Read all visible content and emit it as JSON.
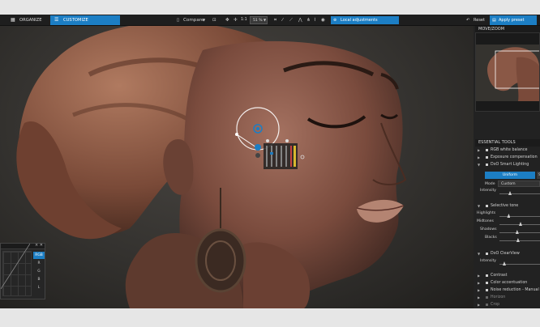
{
  "tabs": {
    "organize": "ORGANIZE",
    "customize": "CUSTOMIZE"
  },
  "toolbar": {
    "compare": "Compare",
    "zoom_ratio": "1:1",
    "zoom_value": "51 %",
    "local_adjustments": "Local adjustments",
    "reset": "Reset",
    "apply_preset": "Apply preset"
  },
  "move_zoom": {
    "title": "MOVE/ZOOM"
  },
  "essential_tools": {
    "title": "ESSENTIAL TOOLS",
    "items_top": [
      "RGB white balance",
      "Exposure compensation",
      "DxO Smart Lighting"
    ],
    "smart_lighting": {
      "mode_uniform": "Uniform",
      "mode_other": "Sp",
      "mode_label": "Mode",
      "mode_value": "Custom",
      "intensity_label": "Intensity"
    },
    "selective_tone": {
      "label": "Selective tone",
      "sliders": [
        "Highlights",
        "Midtones",
        "Shadows",
        "Blacks"
      ],
      "positions": [
        0.22,
        0.5,
        0.42,
        0.44
      ]
    },
    "clearview": {
      "label": "DxO ClearView",
      "intensity_label": "Intensity"
    },
    "items_bottom": [
      "Contrast",
      "Color accentuation",
      "Noise reduction - Manual"
    ],
    "items_dim": [
      "Horizon",
      "Crop"
    ]
  },
  "tone_curve_panel": {
    "channels": [
      "RGB",
      "R",
      "G",
      "B",
      "L"
    ],
    "active": "RGB"
  },
  "colors": {
    "accent": "#1c7ec4",
    "bg": "#2b2b2b",
    "panel": "#222222"
  }
}
